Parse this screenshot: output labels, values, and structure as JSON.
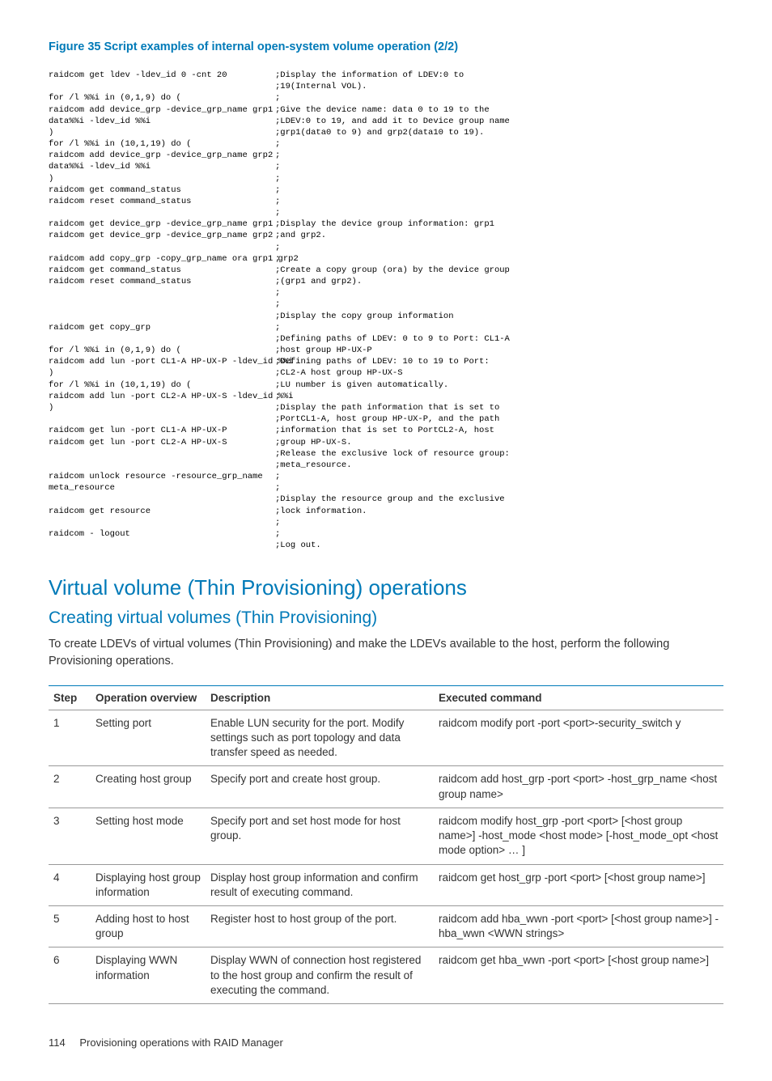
{
  "figure_caption": "Figure 35 Script examples of internal open-system volume operation (2/2)",
  "code": {
    "left": "raidcom get ldev -ldev_id 0 -cnt 20\n\nfor /l %%i in (0,1,9) do (\nraidcom add device_grp -device_grp_name grp1\ndata%%i -ldev_id %%i\n)\nfor /l %%i in (10,1,19) do (\nraidcom add device_grp -device_grp_name grp2\ndata%%i -ldev_id %%i\n)\nraidcom get command_status\nraidcom reset command_status\n\nraidcom get device_grp -device_grp_name grp1\nraidcom get device_grp -device_grp_name grp2\n\nraidcom add copy_grp -copy_grp_name ora grp1 grp2\nraidcom get command_status\nraidcom reset command_status\n\n\n\nraidcom get copy_grp\n\nfor /l %%i in (0,1,9) do (\nraidcom add lun -port CL1-A HP-UX-P -ldev_id %%i\n)\nfor /l %%i in (10,1,19) do (\nraidcom add lun -port CL2-A HP-UX-S -ldev_id %%i\n)\n\nraidcom get lun -port CL1-A HP-UX-P\nraidcom get lun -port CL2-A HP-UX-S\n\n\nraidcom unlock resource -resource_grp_name\nmeta_resource\n\nraidcom get resource\n\nraidcom - logout\n",
    "right": ";Display the information of LDEV:0 to\n;19(Internal VOL).\n;\n;Give the device name: data 0 to 19 to the\n;LDEV:0 to 19, and add it to Device group name\n;grp1(data0 to 9) and grp2(data10 to 19).\n;\n;\n;\n;\n;\n;\n;\n;Display the device group information: grp1\n;and grp2.\n;\n;\n;Create a copy group (ora) by the device group\n;(grp1 and grp2).\n;\n;\n;Display the copy group information\n;\n;Defining paths of LDEV: 0 to 9 to Port: CL1-A\n;host group HP-UX-P\n;Defining paths of LDEV: 10 to 19 to Port:\n;CL2-A host group HP-UX-S\n;LU number is given automatically.\n;\n;Display the path information that is set to\n;PortCL1-A, host group HP-UX-P, and the path\n;information that is set to PortCL2-A, host\n;group HP-UX-S.\n;Release the exclusive lock of resource group:\n;meta_resource.\n;\n;\n;Display the resource group and the exclusive\n;lock information.\n;\n;\n;Log out."
  },
  "h1": "Virtual volume (Thin Provisioning) operations",
  "h2": "Creating virtual volumes (Thin Provisioning)",
  "intro": "To create LDEVs of virtual volumes (Thin Provisioning) and make the LDEVs available to the host, perform the following Provisioning operations.",
  "table": {
    "headers": {
      "step": "Step",
      "op": "Operation overview",
      "desc": "Description",
      "cmd": "Executed command"
    },
    "rows": [
      {
        "step": "1",
        "op": "Setting port",
        "desc": "Enable LUN security for the port. Modify settings such as port topology and data transfer speed as needed.",
        "cmd": "raidcom modify port -port <port>-security_switch y"
      },
      {
        "step": "2",
        "op": "Creating host group",
        "desc": "Specify port and create host group.",
        "cmd": "raidcom add host_grp -port <port> -host_grp_name <host group name>"
      },
      {
        "step": "3",
        "op": "Setting host mode",
        "desc": "Specify port and set host mode for host group.",
        "cmd": "raidcom modify host_grp -port <port> [<host group name>] -host_mode <host mode> [-host_mode_opt <host mode option> … ]"
      },
      {
        "step": "4",
        "op": "Displaying host group information",
        "desc": "Display host group information and confirm result of executing command.",
        "cmd": "raidcom get host_grp -port <port> [<host group name>]"
      },
      {
        "step": "5",
        "op": "Adding host to host group",
        "desc": "Register host to host group of the port.",
        "cmd": "raidcom add hba_wwn -port <port> [<host group name>] -hba_wwn <WWN strings>"
      },
      {
        "step": "6",
        "op": "Displaying WWN information",
        "desc": "Display WWN of connection host registered to the host group and confirm the result of executing the command.",
        "cmd": "raidcom get hba_wwn -port <port> [<host group name>]"
      }
    ]
  },
  "footer": {
    "page": "114",
    "title": "Provisioning operations with RAID Manager"
  }
}
